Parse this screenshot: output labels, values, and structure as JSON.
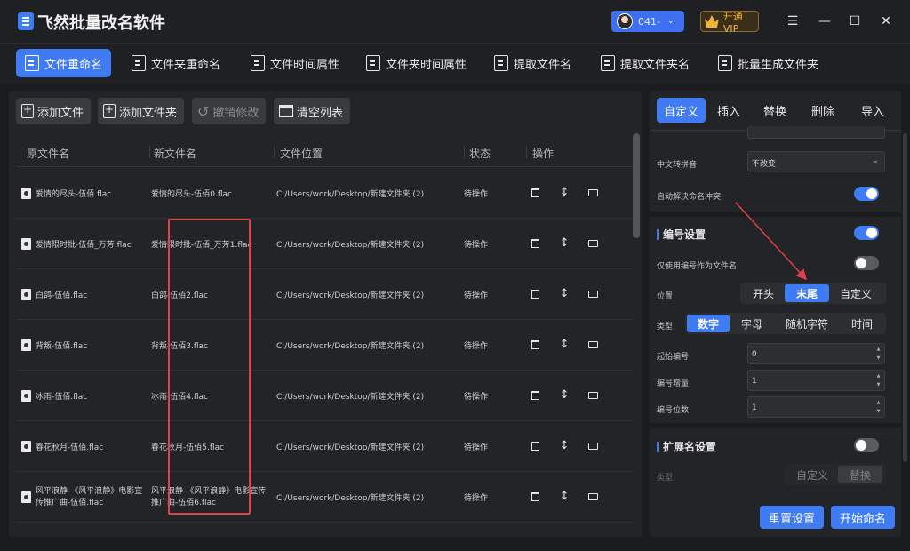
{
  "app": {
    "title": "飞然批量改名软件",
    "user_id": "041-"
  },
  "header": {
    "vip_label": "开通VIP"
  },
  "toolbar": {
    "tabs": [
      {
        "label": "文件重命名",
        "active": true
      },
      {
        "label": "文件夹重命名"
      },
      {
        "label": "文件时间属性"
      },
      {
        "label": "文件夹时间属性"
      },
      {
        "label": "提取文件名"
      },
      {
        "label": "提取文件夹名"
      },
      {
        "label": "批量生成文件夹"
      }
    ]
  },
  "actions": {
    "add_file": "添加文件",
    "add_folder": "添加文件夹",
    "undo": "撤销修改",
    "clear": "清空列表"
  },
  "table": {
    "headers": {
      "original": "原文件名",
      "new": "新文件名",
      "location": "文件位置",
      "status": "状态",
      "ops": "操作"
    },
    "rows": [
      {
        "original": "爱情的尽头-伍佰.flac",
        "new": "爱情的尽头-伍佰0.flac",
        "location": "C:/Users/work/Desktop/新建文件夹 (2)",
        "status": "待操作"
      },
      {
        "original": "爱情限时批-伍佰_万芳.flac",
        "new": "爱情限时批-伍佰_万芳1.flac",
        "location": "C:/Users/work/Desktop/新建文件夹 (2)",
        "status": "待操作"
      },
      {
        "original": "白鸽-伍佰.flac",
        "new": "白鸽-伍佰2.flac",
        "location": "C:/Users/work/Desktop/新建文件夹 (2)",
        "status": "待操作"
      },
      {
        "original": "背叛-伍佰.flac",
        "new": "背叛-伍佰3.flac",
        "location": "C:/Users/work/Desktop/新建文件夹 (2)",
        "status": "待操作"
      },
      {
        "original": "冰雨-伍佰.flac",
        "new": "冰雨-伍佰4.flac",
        "location": "C:/Users/work/Desktop/新建文件夹 (2)",
        "status": "待操作"
      },
      {
        "original": "春花秋月-伍佰.flac",
        "new": "春花秋月-伍佰5.flac",
        "location": "C:/Users/work/Desktop/新建文件夹 (2)",
        "status": "待操作"
      },
      {
        "original": "风平浪静-《风平浪静》电影宣传推广曲-伍佰.flac",
        "new": "风平浪静-《风平浪静》电影宣传推广曲-伍佰6.flac",
        "location": "C:/Users/work/Desktop/新建文件夹 (2)",
        "status": "待操作"
      }
    ]
  },
  "right_panel": {
    "tabs": [
      {
        "label": "自定义",
        "active": true
      },
      {
        "label": "插入"
      },
      {
        "label": "替换"
      },
      {
        "label": "删除"
      },
      {
        "label": "导入"
      }
    ],
    "pinyin": {
      "label": "中文转拼音",
      "value": "不改变"
    },
    "auto_resolve": {
      "label": "自动解决命名冲突",
      "on": true
    },
    "numbering": {
      "title": "编号设置",
      "on": true,
      "only_number": {
        "label": "仅使用编号作为文件名",
        "on": false
      },
      "position": {
        "label": "位置",
        "options": [
          "开头",
          "末尾",
          "自定义"
        ],
        "selected": "末尾"
      },
      "type": {
        "label": "类型",
        "options": [
          "数字",
          "字母",
          "随机字符",
          "时间"
        ],
        "selected": "数字"
      },
      "start": {
        "label": "起始编号",
        "value": "0"
      },
      "step": {
        "label": "编号增量",
        "value": "1"
      },
      "digits": {
        "label": "编号位数",
        "value": "1"
      }
    },
    "extension": {
      "title": "扩展名设置",
      "on": false,
      "type": {
        "label": "类型",
        "options": [
          "自定义",
          "替换"
        ],
        "selected": "替换"
      }
    },
    "buttons": {
      "reset": "重置设置",
      "start": "开始命名"
    }
  },
  "colors": {
    "accent": "#3f7cf3",
    "highlight": "#e0414b",
    "bg": "#1b1c1f",
    "panel": "#232427"
  }
}
